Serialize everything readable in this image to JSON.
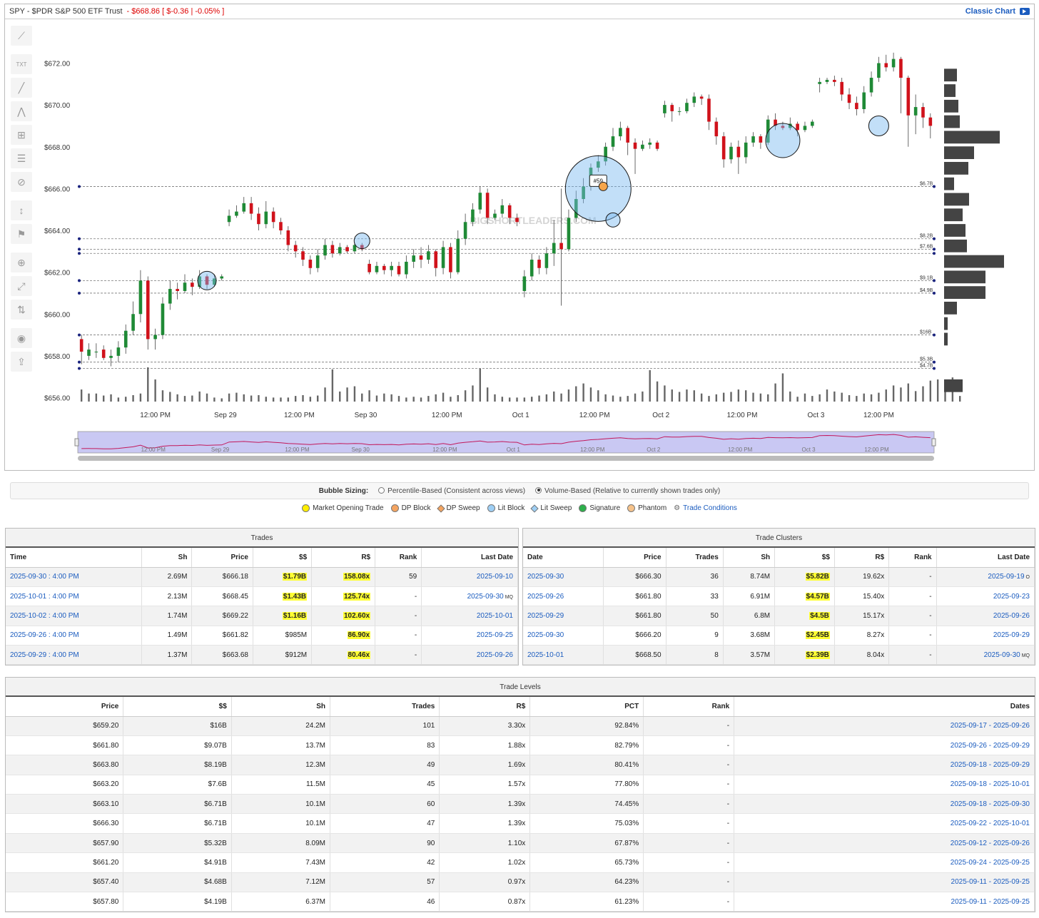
{
  "header": {
    "symbol_text": "SPY - $PDR S&P 500 ETF Trust",
    "price_text": "- $668.86 [ $-0.36 | -0.05% ]",
    "classic_chart_label": "Classic Chart"
  },
  "watermark": "BIGSHORTLEADERS.COM",
  "chart_data": {
    "type": "candlestick",
    "y_ticks": [
      "$672.00",
      "$670.00",
      "$668.00",
      "$666.00",
      "$664.00",
      "$662.00",
      "$660.00",
      "$658.00",
      "$656.00"
    ],
    "y_tick_values": [
      672,
      670,
      668,
      666,
      664,
      662,
      660,
      658,
      656
    ],
    "ylim": [
      656,
      673
    ],
    "x_ticks": [
      "12:00 PM",
      "Sep 29",
      "12:00 PM",
      "Sep 30",
      "12:00 PM",
      "Oct 1",
      "12:00 PM",
      "Oct 2",
      "12:00 PM",
      "Oct 3",
      "12:00 PM"
    ],
    "candles": [
      [
        658.8,
        658.2,
        659.0,
        657.6
      ],
      [
        658.0,
        658.3,
        658.6,
        657.8
      ],
      [
        658.2,
        658.2,
        658.6,
        657.9
      ],
      [
        658.3,
        657.9,
        658.5,
        657.8
      ],
      [
        657.9,
        658.0,
        658.3,
        657.5
      ],
      [
        658.0,
        658.4,
        658.7,
        657.7
      ],
      [
        658.4,
        659.2,
        659.5,
        658.1
      ],
      [
        659.2,
        660.0,
        660.6,
        659.0
      ],
      [
        660.0,
        661.6,
        662.1,
        659.6
      ],
      [
        661.6,
        658.8,
        661.8,
        658.3
      ],
      [
        658.8,
        659.0,
        659.3,
        658.3
      ],
      [
        659.0,
        660.5,
        660.8,
        658.8
      ],
      [
        660.5,
        661.2,
        661.6,
        660.2
      ],
      [
        661.2,
        661.1,
        661.5,
        660.7
      ],
      [
        661.1,
        661.5,
        661.9,
        661.0
      ],
      [
        661.5,
        661.3,
        661.7,
        660.9
      ],
      [
        661.3,
        661.8,
        662.1,
        661.2
      ],
      [
        661.8,
        661.4,
        661.9,
        661.2
      ],
      [
        661.4,
        661.7,
        661.9,
        661.3
      ],
      [
        661.7,
        661.8,
        661.9,
        661.6
      ],
      [
        664.4,
        664.7,
        665.0,
        664.2
      ],
      [
        664.7,
        664.9,
        665.2,
        664.6
      ],
      [
        664.9,
        665.3,
        665.6,
        664.8
      ],
      [
        665.3,
        664.8,
        665.6,
        664.5
      ],
      [
        664.8,
        664.3,
        665.1,
        664.0
      ],
      [
        664.3,
        664.9,
        665.4,
        664.1
      ],
      [
        664.9,
        664.4,
        665.1,
        664.1
      ],
      [
        664.4,
        664.0,
        664.6,
        663.8
      ],
      [
        664.0,
        663.3,
        664.2,
        663.0
      ],
      [
        663.3,
        663.0,
        663.5,
        662.7
      ],
      [
        663.0,
        662.6,
        663.2,
        662.3
      ],
      [
        662.6,
        662.2,
        662.8,
        661.9
      ],
      [
        662.2,
        662.8,
        663.1,
        662.0
      ],
      [
        662.8,
        663.3,
        663.6,
        662.6
      ],
      [
        663.3,
        662.9,
        663.5,
        662.7
      ],
      [
        662.9,
        663.2,
        663.4,
        662.8
      ],
      [
        663.2,
        663.0,
        663.3,
        662.9
      ],
      [
        663.0,
        663.3,
        663.4,
        662.9
      ],
      [
        663.3,
        663.1,
        663.4,
        663.0
      ],
      [
        662.4,
        662.0,
        662.6,
        661.9
      ],
      [
        662.0,
        662.3,
        662.5,
        661.9
      ],
      [
        662.3,
        662.1,
        662.4,
        661.9
      ],
      [
        662.1,
        662.3,
        662.5,
        661.8
      ],
      [
        662.3,
        661.9,
        662.5,
        661.8
      ],
      [
        661.9,
        662.5,
        662.8,
        661.7
      ],
      [
        662.5,
        662.8,
        663.1,
        662.2
      ],
      [
        662.8,
        662.6,
        663.2,
        662.2
      ],
      [
        662.6,
        663.0,
        663.3,
        662.4
      ],
      [
        663.0,
        662.2,
        663.1,
        661.8
      ],
      [
        662.2,
        663.2,
        663.5,
        661.9
      ],
      [
        663.2,
        662.0,
        663.4,
        661.7
      ],
      [
        662.0,
        663.6,
        664.0,
        661.9
      ],
      [
        663.6,
        664.4,
        664.8,
        663.3
      ],
      [
        664.4,
        665.0,
        665.3,
        664.2
      ],
      [
        665.0,
        665.8,
        666.1,
        664.8
      ],
      [
        665.8,
        664.6,
        666.0,
        664.3
      ],
      [
        664.6,
        664.8,
        665.0,
        664.5
      ],
      [
        664.8,
        665.2,
        665.5,
        664.6
      ],
      [
        665.2,
        664.6,
        665.3,
        664.3
      ],
      [
        664.6,
        664.4,
        664.8,
        664.2
      ],
      [
        661.1,
        661.8,
        662.1,
        660.8
      ],
      [
        661.8,
        662.6,
        662.9,
        661.6
      ],
      [
        662.6,
        662.2,
        662.8,
        661.9
      ],
      [
        662.2,
        662.9,
        663.2,
        661.9
      ],
      [
        662.9,
        663.4,
        664.5,
        662.3
      ],
      [
        663.4,
        663.1,
        666.0,
        660.4
      ],
      [
        663.1,
        664.6,
        665.0,
        663.0
      ],
      [
        664.6,
        665.5,
        665.9,
        664.4
      ],
      [
        665.5,
        666.1,
        666.5,
        665.3
      ],
      [
        666.1,
        667.0,
        667.2,
        665.9
      ],
      [
        667.0,
        667.3,
        667.6,
        666.8
      ],
      [
        667.3,
        668.0,
        668.2,
        667.1
      ],
      [
        668.0,
        668.5,
        668.9,
        667.8
      ],
      [
        668.5,
        668.9,
        669.2,
        668.3
      ],
      [
        668.9,
        668.2,
        669.0,
        667.6
      ],
      [
        668.2,
        667.9,
        668.4,
        666.7
      ],
      [
        667.9,
        668.1,
        668.3,
        667.8
      ],
      [
        668.1,
        668.2,
        668.4,
        667.9
      ],
      [
        668.2,
        667.9,
        668.3,
        667.8
      ],
      [
        669.6,
        670.0,
        670.2,
        669.4
      ],
      [
        670.0,
        669.7,
        670.1,
        669.2
      ],
      [
        669.7,
        669.7,
        669.9,
        669.5
      ],
      [
        669.7,
        670.1,
        670.3,
        669.6
      ],
      [
        670.1,
        670.4,
        670.6,
        669.9
      ],
      [
        670.4,
        670.3,
        670.5,
        670.0
      ],
      [
        670.3,
        669.2,
        670.5,
        668.8
      ],
      [
        669.2,
        668.5,
        669.4,
        668.1
      ],
      [
        668.5,
        667.4,
        668.7,
        667.0
      ],
      [
        667.4,
        668.0,
        668.2,
        667.2
      ],
      [
        668.0,
        667.5,
        668.3,
        666.7
      ],
      [
        667.5,
        668.2,
        668.5,
        667.2
      ],
      [
        668.2,
        668.5,
        668.7,
        668.0
      ],
      [
        668.5,
        668.2,
        668.6,
        667.9
      ],
      [
        668.2,
        669.3,
        669.5,
        668.1
      ],
      [
        669.3,
        669.0,
        669.6,
        668.8
      ],
      [
        669.0,
        668.9,
        669.2,
        668.8
      ],
      [
        668.9,
        669.1,
        669.4,
        668.8
      ],
      [
        669.1,
        668.8,
        669.2,
        668.5
      ],
      [
        668.8,
        669.0,
        669.2,
        668.7
      ],
      [
        669.0,
        669.2,
        669.3,
        668.9
      ],
      [
        671.0,
        671.1,
        671.3,
        670.6
      ],
      [
        671.1,
        671.2,
        671.3,
        671.0
      ],
      [
        671.2,
        671.1,
        671.4,
        670.9
      ],
      [
        671.1,
        670.5,
        671.3,
        670.2
      ],
      [
        670.5,
        670.1,
        670.8,
        669.8
      ],
      [
        670.1,
        669.8,
        670.4,
        669.5
      ],
      [
        669.8,
        670.6,
        670.9,
        669.6
      ],
      [
        670.6,
        671.3,
        671.6,
        670.4
      ],
      [
        671.3,
        672.0,
        672.3,
        671.1
      ],
      [
        672.0,
        671.8,
        672.4,
        671.6
      ],
      [
        671.8,
        672.2,
        672.5,
        671.6
      ],
      [
        672.2,
        671.3,
        672.3,
        669.6
      ],
      [
        671.3,
        669.5,
        671.4,
        668.0
      ],
      [
        669.5,
        669.9,
        670.5,
        668.6
      ],
      [
        669.9,
        669.4,
        670.1,
        668.9
      ],
      [
        669.4,
        669.0,
        669.6,
        668.4
      ]
    ],
    "volumes": [
      30,
      20,
      20,
      15,
      18,
      10,
      12,
      16,
      20,
      85,
      55,
      28,
      24,
      18,
      14,
      15,
      25,
      20,
      10,
      8,
      20,
      22,
      18,
      15,
      16,
      12,
      10,
      10,
      10,
      14,
      16,
      12,
      15,
      35,
      80,
      25,
      35,
      38,
      20,
      28,
      15,
      20,
      18,
      14,
      10,
      12,
      10,
      14,
      18,
      22,
      12,
      16,
      28,
      40,
      82,
      35,
      18,
      12,
      10,
      10,
      10,
      12,
      15,
      18,
      25,
      20,
      30,
      38,
      45,
      35,
      28,
      18,
      15,
      12,
      14,
      20,
      25,
      78,
      50,
      40,
      30,
      24,
      30,
      28,
      20,
      14,
      18,
      22,
      24,
      30,
      28,
      22,
      20,
      18,
      45,
      70,
      25,
      12,
      20,
      14,
      18,
      30,
      25,
      22,
      16,
      14,
      20,
      18,
      22,
      30,
      40,
      35,
      45,
      26,
      38,
      52,
      55,
      40,
      60,
      14
    ],
    "day_starts": [
      0,
      20,
      39,
      60,
      79,
      100
    ],
    "bubbles": [
      {
        "x_index": 17,
        "price": 661.6,
        "r": 13
      },
      {
        "x_index": 38,
        "price": 663.5,
        "r": 11
      },
      {
        "x_index": 70,
        "price": 666.0,
        "r": 46,
        "label": "#59"
      },
      {
        "x_index": 72,
        "price": 664.5,
        "r": 10
      },
      {
        "x_index": 95,
        "price": 668.3,
        "r": 24
      },
      {
        "x_index": 108,
        "price": 669.0,
        "r": 14
      }
    ],
    "levels": [
      {
        "price": 666.1,
        "label": "$6.7B"
      },
      {
        "price": 663.6,
        "label": "$8.2B"
      },
      {
        "price": 663.1,
        "label": "$7.6B"
      },
      {
        "price": 662.9,
        "label": ""
      },
      {
        "price": 661.6,
        "label": "$9.1B"
      },
      {
        "price": 661.0,
        "label": "$4.9B"
      },
      {
        "price": 659.0,
        "label": "$16B"
      },
      {
        "price": 657.7,
        "label": "$5.3B"
      },
      {
        "price": 657.4,
        "label": "$4.7B"
      }
    ],
    "volume_profile": [
      18,
      16,
      20,
      22,
      78,
      42,
      34,
      14,
      35,
      26,
      30,
      32,
      84,
      58,
      58,
      18,
      5,
      5,
      0,
      0,
      26
    ],
    "nav_x_labels": [
      "12:00 PM",
      "Sep 29",
      "12:00 PM",
      "Sep 30",
      "12:00 PM",
      "Oct 1",
      "12:00 PM",
      "Oct 2",
      "12:00 PM",
      "Oct 3",
      "12:00 PM"
    ]
  },
  "bubble_sizing": {
    "label": "Bubble Sizing:",
    "option1": "Percentile-Based (Consistent across views)",
    "option2": "Volume-Based (Relative to currently shown trades only)"
  },
  "legend": [
    {
      "label": "Market Opening Trade",
      "color": "#ffee00",
      "shape": "circle"
    },
    {
      "label": "DP Block",
      "color": "#f4a460",
      "shape": "circle"
    },
    {
      "label": "DP Sweep",
      "color": "#f4a460",
      "shape": "diamond"
    },
    {
      "label": "Lit Block",
      "color": "#9ecff5",
      "shape": "circle"
    },
    {
      "label": "Lit Sweep",
      "color": "#9ecff5",
      "shape": "diamond"
    },
    {
      "label": "Signature",
      "color": "#2db04b",
      "shape": "circle"
    },
    {
      "label": "Phantom",
      "color": "#f6c28a",
      "shape": "circle"
    }
  ],
  "legend_link": "Trade Conditions",
  "trades": {
    "title": "Trades",
    "headers": [
      "Time",
      "Sh",
      "Price",
      "$$",
      "R$",
      "Rank",
      "Last Date"
    ],
    "rows": [
      {
        "time": "2025-09-30 : 4:00 PM",
        "sh": "2.69M",
        "price": "$666.18",
        "dollars": "$1.79B",
        "rs": "158.08x",
        "rank": "59",
        "last": "2025-09-10",
        "hl_d": true,
        "hl_r": true,
        "tag": ""
      },
      {
        "time": "2025-10-01 : 4:00 PM",
        "sh": "2.13M",
        "price": "$668.45",
        "dollars": "$1.43B",
        "rs": "125.74x",
        "rank": "-",
        "last": "2025-09-30",
        "hl_d": true,
        "hl_r": true,
        "tag": "MQ"
      },
      {
        "time": "2025-10-02 : 4:00 PM",
        "sh": "1.74M",
        "price": "$669.22",
        "dollars": "$1.16B",
        "rs": "102.60x",
        "rank": "-",
        "last": "2025-10-01",
        "hl_d": true,
        "hl_r": true,
        "tag": ""
      },
      {
        "time": "2025-09-26 : 4:00 PM",
        "sh": "1.49M",
        "price": "$661.82",
        "dollars": "$985M",
        "rs": "86.90x",
        "rank": "-",
        "last": "2025-09-25",
        "hl_d": false,
        "hl_r": true,
        "tag": ""
      },
      {
        "time": "2025-09-29 : 4:00 PM",
        "sh": "1.37M",
        "price": "$663.68",
        "dollars": "$912M",
        "rs": "80.46x",
        "rank": "-",
        "last": "2025-09-26",
        "hl_d": false,
        "hl_r": true,
        "tag": ""
      }
    ]
  },
  "clusters": {
    "title": "Trade Clusters",
    "headers": [
      "Date",
      "Price",
      "Trades",
      "Sh",
      "$$",
      "R$",
      "Rank",
      "Last Date"
    ],
    "rows": [
      {
        "date": "2025-09-30",
        "price": "$666.30",
        "trades": "36",
        "sh": "8.74M",
        "dollars": "$5.82B",
        "rs": "19.62x",
        "rank": "-",
        "last": "2025-09-19",
        "tag": "O"
      },
      {
        "date": "2025-09-26",
        "price": "$661.80",
        "trades": "33",
        "sh": "6.91M",
        "dollars": "$4.57B",
        "rs": "15.40x",
        "rank": "-",
        "last": "2025-09-23",
        "tag": ""
      },
      {
        "date": "2025-09-29",
        "price": "$661.80",
        "trades": "50",
        "sh": "6.8M",
        "dollars": "$4.5B",
        "rs": "15.17x",
        "rank": "-",
        "last": "2025-09-26",
        "tag": ""
      },
      {
        "date": "2025-09-30",
        "price": "$666.20",
        "trades": "9",
        "sh": "3.68M",
        "dollars": "$2.45B",
        "rs": "8.27x",
        "rank": "-",
        "last": "2025-09-29",
        "tag": ""
      },
      {
        "date": "2025-10-01",
        "price": "$668.50",
        "trades": "8",
        "sh": "3.57M",
        "dollars": "$2.39B",
        "rs": "8.04x",
        "rank": "-",
        "last": "2025-09-30",
        "tag": "MQ"
      }
    ]
  },
  "levels_table": {
    "title": "Trade Levels",
    "headers": [
      "Price",
      "$$",
      "Sh",
      "Trades",
      "R$",
      "PCT",
      "Rank",
      "Dates"
    ],
    "rows": [
      {
        "price": "$659.20",
        "dollars": "$16B",
        "sh": "24.2M",
        "trades": "101",
        "rs": "3.30x",
        "pct": "92.84%",
        "rank": "-",
        "dates": "2025-09-17 - 2025-09-26"
      },
      {
        "price": "$661.80",
        "dollars": "$9.07B",
        "sh": "13.7M",
        "trades": "83",
        "rs": "1.88x",
        "pct": "82.79%",
        "rank": "-",
        "dates": "2025-09-26 - 2025-09-29"
      },
      {
        "price": "$663.80",
        "dollars": "$8.19B",
        "sh": "12.3M",
        "trades": "49",
        "rs": "1.69x",
        "pct": "80.41%",
        "rank": "-",
        "dates": "2025-09-18 - 2025-09-29"
      },
      {
        "price": "$663.20",
        "dollars": "$7.6B",
        "sh": "11.5M",
        "trades": "45",
        "rs": "1.57x",
        "pct": "77.80%",
        "rank": "-",
        "dates": "2025-09-18 - 2025-10-01"
      },
      {
        "price": "$663.10",
        "dollars": "$6.71B",
        "sh": "10.1M",
        "trades": "60",
        "rs": "1.39x",
        "pct": "74.45%",
        "rank": "-",
        "dates": "2025-09-18 - 2025-09-30"
      },
      {
        "price": "$666.30",
        "dollars": "$6.71B",
        "sh": "10.1M",
        "trades": "47",
        "rs": "1.39x",
        "pct": "75.03%",
        "rank": "-",
        "dates": "2025-09-22 - 2025-10-01"
      },
      {
        "price": "$657.90",
        "dollars": "$5.32B",
        "sh": "8.09M",
        "trades": "90",
        "rs": "1.10x",
        "pct": "67.87%",
        "rank": "-",
        "dates": "2025-09-12 - 2025-09-26"
      },
      {
        "price": "$661.20",
        "dollars": "$4.91B",
        "sh": "7.43M",
        "trades": "42",
        "rs": "1.02x",
        "pct": "65.73%",
        "rank": "-",
        "dates": "2025-09-24 - 2025-09-25"
      },
      {
        "price": "$657.40",
        "dollars": "$4.68B",
        "sh": "7.12M",
        "trades": "57",
        "rs": "0.97x",
        "pct": "64.23%",
        "rank": "-",
        "dates": "2025-09-11 - 2025-09-25"
      },
      {
        "price": "$657.80",
        "dollars": "$4.19B",
        "sh": "6.37M",
        "trades": "46",
        "rs": "0.87x",
        "pct": "61.23%",
        "rank": "-",
        "dates": "2025-09-11 - 2025-09-25"
      }
    ]
  },
  "toolbar_icons": [
    "trend-icon",
    "text-icon",
    "line-icon",
    "fib-icon",
    "crosshair-icon",
    "grid-icon",
    "hide-icon",
    "measure-icon",
    "flag-icon",
    "zoom-icon",
    "expand-icon",
    "adjust-icon",
    "eye-icon",
    "export-icon"
  ]
}
